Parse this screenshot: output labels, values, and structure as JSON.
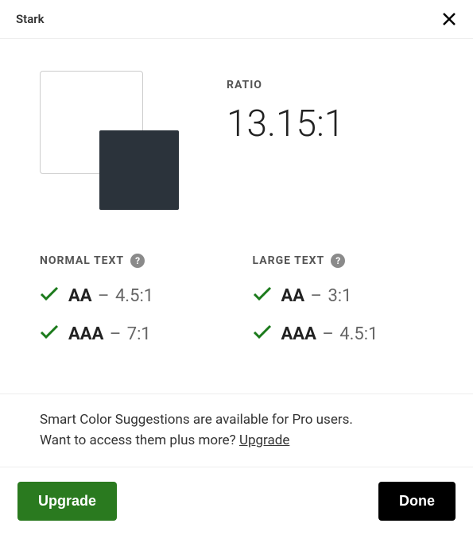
{
  "header": {
    "title": "Stark"
  },
  "swatches": {
    "bg": "#ffffff",
    "fg": "#2b333b"
  },
  "ratio": {
    "label": "RATIO",
    "value": "13.15:1"
  },
  "normal": {
    "heading": "NORMAL TEXT",
    "items": [
      {
        "level": "AA",
        "threshold": "4.5:1",
        "pass": true
      },
      {
        "level": "AAA",
        "threshold": "7:1",
        "pass": true
      }
    ]
  },
  "large": {
    "heading": "LARGE TEXT",
    "items": [
      {
        "level": "AA",
        "threshold": "3:1",
        "pass": true
      },
      {
        "level": "AAA",
        "threshold": "4.5:1",
        "pass": true
      }
    ]
  },
  "promo": {
    "line1": "Smart Color Suggestions are available for Pro users.",
    "line2_prefix": "Want to access them plus more? ",
    "link": "Upgrade"
  },
  "footer": {
    "upgrade": "Upgrade",
    "done": "Done"
  },
  "info_glyph": "?"
}
